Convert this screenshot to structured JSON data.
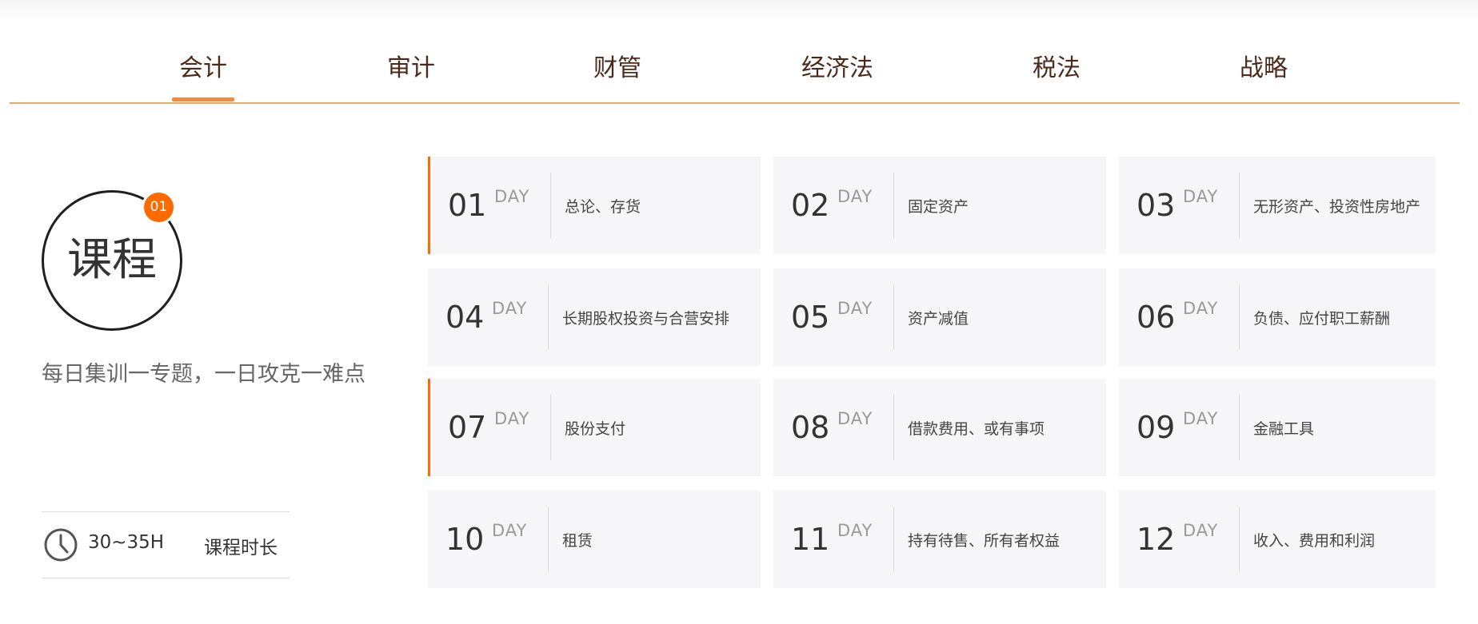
{
  "tabs": {
    "items": [
      {
        "label": "会计"
      },
      {
        "label": "审计"
      },
      {
        "label": "财管"
      },
      {
        "label": "经济法"
      },
      {
        "label": "税法"
      },
      {
        "label": "战略"
      }
    ],
    "selected": "会计",
    "accent_color": "#f18a3c",
    "line_color": "#e4ab66"
  },
  "course": {
    "title": "课程",
    "badge_number": "01",
    "badge_color": "#ff6a00",
    "slogan": "每日集训一专题，一日攻克一难点",
    "duration_icon": "clock-icon",
    "duration_value": "30~35H",
    "duration_label": "课程时长"
  },
  "days": [
    {
      "num": "01",
      "day": "DAY",
      "topic": "总论、存货",
      "active": true
    },
    {
      "num": "02",
      "day": "DAY",
      "topic": "固定资产",
      "active": false
    },
    {
      "num": "03",
      "day": "DAY",
      "topic": "无形资产、投资性房地产",
      "active": false
    },
    {
      "num": "04",
      "day": "DAY",
      "topic": "长期股权投资与合营安排",
      "active": false
    },
    {
      "num": "05",
      "day": "DAY",
      "topic": "资产减值",
      "active": false
    },
    {
      "num": "06",
      "day": "DAY",
      "topic": "负债、应付职工薪酬",
      "active": false
    },
    {
      "num": "07",
      "day": "DAY",
      "topic": "股份支付",
      "active": true
    },
    {
      "num": "08",
      "day": "DAY",
      "topic": "借款费用、或有事项",
      "active": false
    },
    {
      "num": "09",
      "day": "DAY",
      "topic": "金融工具",
      "active": false
    },
    {
      "num": "10",
      "day": "DAY",
      "topic": "租赁",
      "active": false
    },
    {
      "num": "11",
      "day": "DAY",
      "topic": "持有待售、所有者权益",
      "active": false
    },
    {
      "num": "12",
      "day": "DAY",
      "topic": "收入、费用和利润",
      "active": false
    }
  ]
}
